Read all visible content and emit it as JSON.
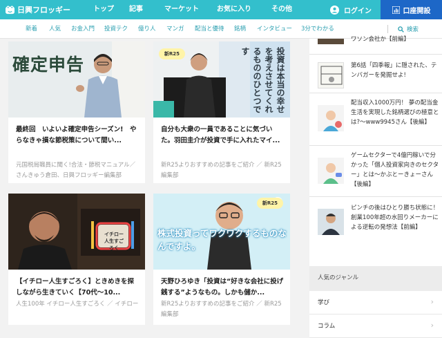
{
  "header": {
    "logo_text": "日興フロッギー",
    "nav": [
      "トップ",
      "記事",
      "マーケット",
      "お気に入り",
      "その他"
    ],
    "login_label": "ログイン",
    "account_label": "口座開設"
  },
  "subnav": {
    "items": [
      "新着",
      "人気",
      "お金入門",
      "投資テク",
      "億り人",
      "マンガ",
      "配当と優待",
      "銘柄",
      "インタビュー",
      "3分でわかる"
    ],
    "search_label": "検索"
  },
  "cards": [
    {
      "image_text": "確定申告",
      "title": "最終回　いよいよ確定申告シーズン!　やらなきゃ損な節税策について間い...",
      "meta": "元国税局職員に聞く!合法・節税マニュアル／さんきゅう倉田、日興フロッギー編集部"
    },
    {
      "image_text": "投資は本当の幸せを考えさせてくれるもののひとつです",
      "badge": "新R25",
      "title": "自分も大衆の一員であることに気づいた。羽田圭介が投資で手に入れたマイ...",
      "meta": "新R25よりおすすめの記事をご紹介 ／ 新R25編集部"
    },
    {
      "image_text": "イチロー人生すごろく",
      "title": "【イチロー人生すごろく】ときめきを探しながら生きていく【70代〜10...",
      "meta": "人生100年 イチロー人生すごろく ／ イチロー"
    },
    {
      "image_text": "株式投資ってワクワクするものなんですよ。",
      "badge": "新R25",
      "title": "天野ひろゆき「投資は“好きな会社に投げ銭する”ようなもの。しかも儲か...",
      "meta": "新R25よりおすすめの記事をご紹介 ／ 新R25編集部"
    }
  ],
  "sidebar": {
    "items": [
      {
        "text": "ワソン会社か【前編】"
      },
      {
        "text": "第6話「四季報」に隠された、テンバガーを発掘せよ!"
      },
      {
        "text": "配当収入1000万円！ 夢の配当金生活を実現した銘柄選びの極意とは?〜www9945さん【後編】"
      },
      {
        "text": "ゲームセクターで4億円稼いで分かった「個人投資家向きのセクター」とは〜かぶとーきょーさん【後編】"
      },
      {
        "text": "ピンチの後はひとり勝ち状態に！ 創業100年超の水回りメーカーによる逆転の発想法【前編】"
      }
    ],
    "genre_title": "人気のジャンル",
    "genres": [
      "学び",
      "コラム"
    ]
  },
  "colors": {
    "accent": "#33bfcc",
    "account": "#1d67c7",
    "link": "#2a9fb0"
  }
}
